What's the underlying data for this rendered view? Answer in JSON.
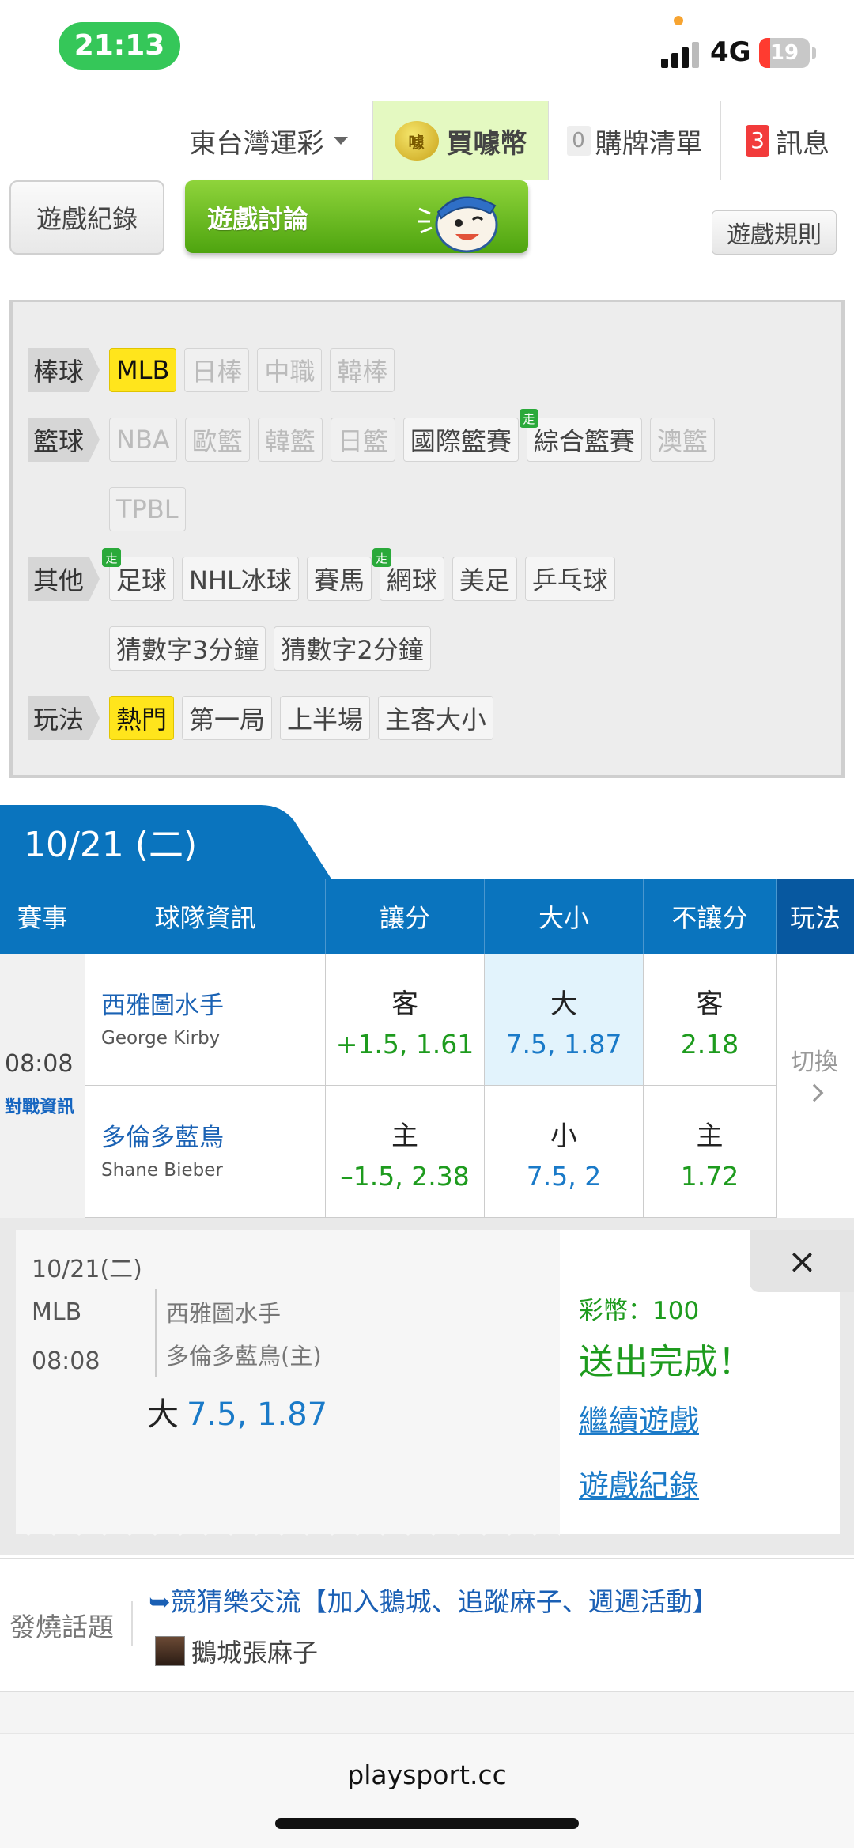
{
  "status_bar": {
    "time": "21:13",
    "network": "4G",
    "battery": "19",
    "battery_level": 0.19
  },
  "top_nav": {
    "lottery": "東台灣運彩",
    "buy_coin": "買噱幣",
    "coin_icon_text": "噱",
    "cart_count": "0",
    "cart": "購牌清單",
    "msg_count": "3",
    "messages": "訊息"
  },
  "game_bar": {
    "record": "遊戲紀錄",
    "discuss": "遊戲討論",
    "rules": "遊戲規則"
  },
  "filters": {
    "baseball": {
      "label": "棒球",
      "items": [
        "MLB",
        "日棒",
        "中職",
        "韓棒"
      ]
    },
    "basketball": {
      "label": "籃球",
      "items": [
        "NBA",
        "歐籃",
        "韓籃",
        "日籃",
        "國際籃賽",
        "綜合籃賽",
        "澳籃",
        "TPBL"
      ]
    },
    "other": {
      "label": "其他",
      "items": [
        "足球",
        "NHL冰球",
        "賽馬",
        "網球",
        "美足",
        "乒乓球",
        "猜數字3分鐘",
        "猜數字2分鐘"
      ]
    },
    "play": {
      "label": "玩法",
      "items": [
        "熱門",
        "第一局",
        "上半場",
        "主客大小"
      ]
    },
    "walk_badge": "走"
  },
  "date_tab": "10/21 (二)",
  "table": {
    "headers": [
      "賽事",
      "球隊資訊",
      "讓分",
      "大小",
      "不讓分",
      "玩法"
    ],
    "event_time": "08:08",
    "event_info": "對戰資訊",
    "rows": [
      {
        "team": "西雅圖水手",
        "pitcher": "George Kirby",
        "spread_side": "客",
        "spread": "+1.5, 1.61",
        "total_side": "大",
        "total": "7.5, 1.87",
        "ml_side": "客",
        "ml": "2.18"
      },
      {
        "team": "多倫多藍鳥",
        "pitcher": "Shane Bieber",
        "spread_side": "主",
        "spread": "–1.5, 2.38",
        "total_side": "小",
        "total": "7.5, 2",
        "ml_side": "主",
        "ml": "1.72"
      }
    ],
    "switch": "切換"
  },
  "confirm": {
    "date": "10/21(二)",
    "league": "MLB",
    "time": "08:08",
    "away": "西雅圖水手",
    "home": "多倫多藍鳥(主)",
    "pick_side": "大",
    "pick_value": "7.5, 1.87",
    "close": "×",
    "coins": "彩幣：100",
    "done": "送出完成！",
    "continue": "繼續遊戲",
    "record": "遊戲紀錄"
  },
  "hot_topic": {
    "label": "發燒話題",
    "link": "➥競猜樂交流【加入鵝城、追蹤麻子、週週活動】",
    "author": "鵝城張麻子"
  },
  "url": "playsport.cc",
  "colors": {
    "header_blue": "#0a74be",
    "green": "#1e9b1e",
    "link_blue": "#1a7ac8",
    "selected_yellow": "#ffe51c"
  }
}
